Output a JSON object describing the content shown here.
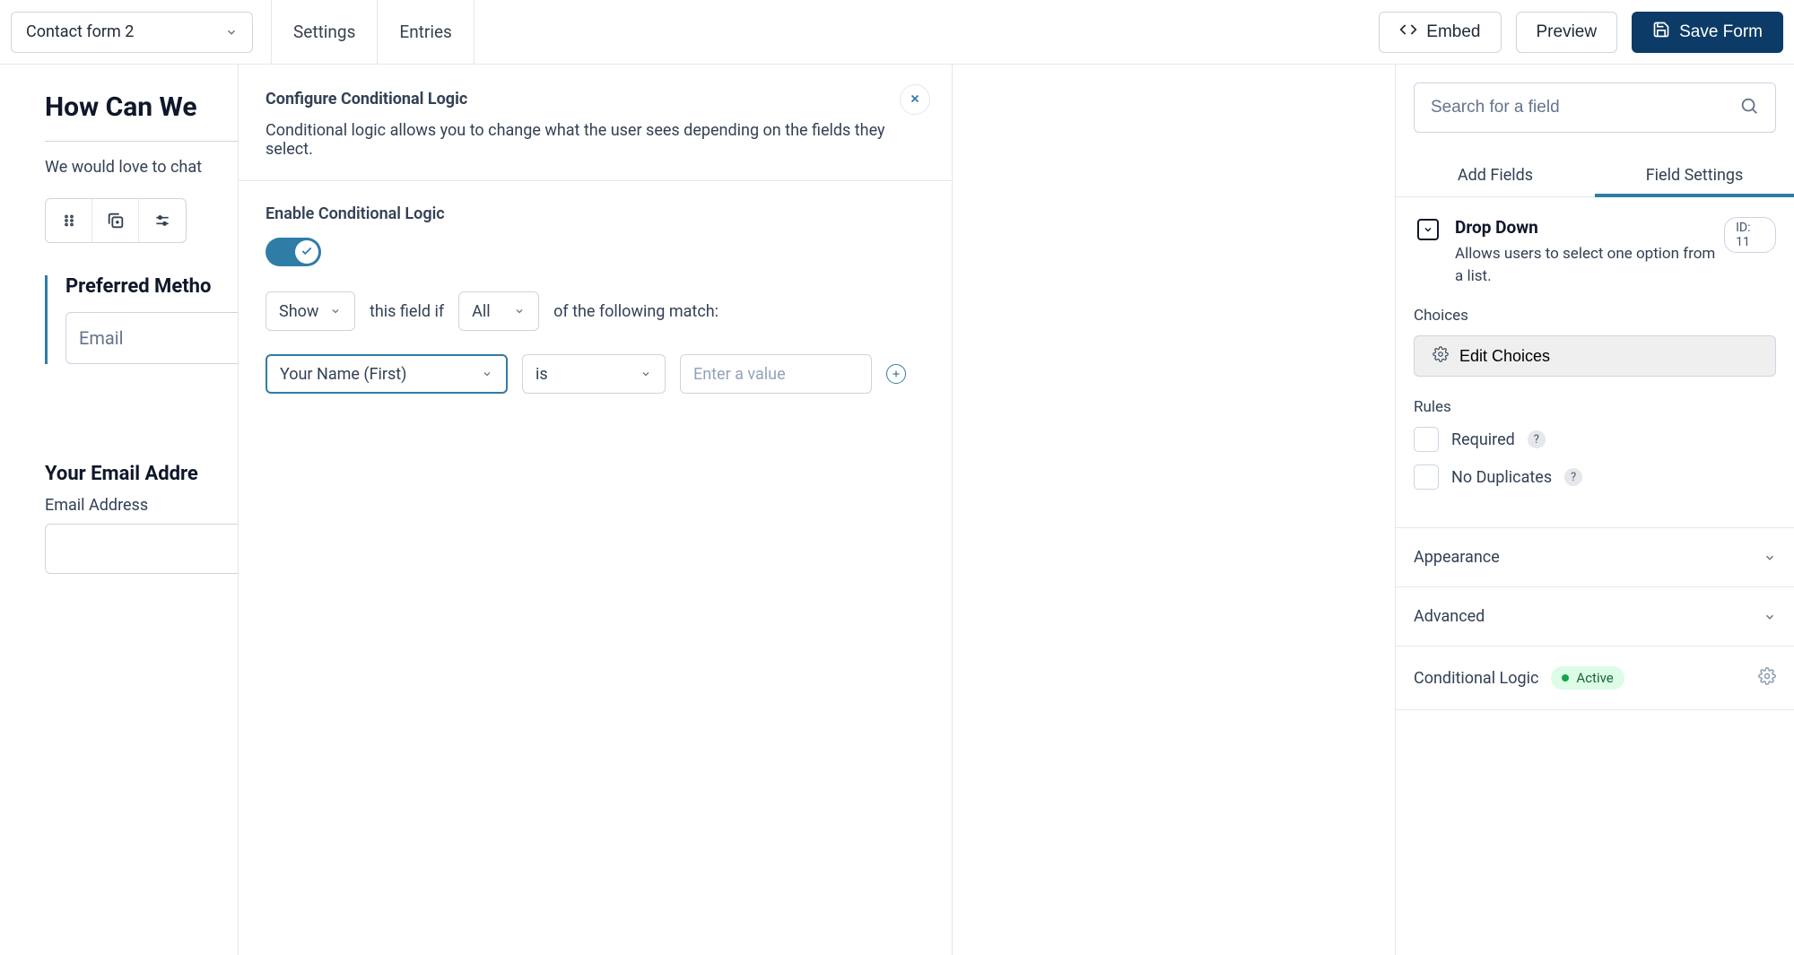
{
  "topbar": {
    "form_name": "Contact form 2",
    "nav": {
      "settings": "Settings",
      "entries": "Entries"
    },
    "embed": "Embed",
    "preview": "Preview",
    "save": "Save Form"
  },
  "canvas": {
    "heading_truncated": "How Can We",
    "description_truncated": "We would love to chat",
    "selected_field_label_truncated": "Preferred Metho",
    "selected_field_value": "Email",
    "email_block": {
      "heading": "Your Email Addre",
      "sublabel": "Email Address"
    }
  },
  "cond_panel": {
    "title": "Configure Conditional Logic",
    "description": "Conditional logic allows you to change what the user sees depending on the fields they select.",
    "enable_label": "Enable Conditional Logic",
    "toggle_on": true,
    "rule_sentence": {
      "action_select": "Show",
      "mid_text_1": "this field if",
      "match_select": "All",
      "mid_text_2": "of the following match:"
    },
    "rule": {
      "field": "Your Name (First)",
      "operator": "is",
      "value_placeholder": "Enter a value"
    }
  },
  "sidebar": {
    "search_placeholder": "Search for a field",
    "tabs": {
      "add": "Add Fields",
      "settings": "Field Settings"
    },
    "field": {
      "type": "Drop Down",
      "id_badge": "ID: 11",
      "description": "Allows users to select one option from a list."
    },
    "choices": {
      "label": "Choices",
      "edit_button": "Edit Choices"
    },
    "rules": {
      "label": "Rules",
      "required": "Required",
      "no_duplicates": "No Duplicates"
    },
    "accordion": {
      "appearance": "Appearance",
      "advanced": "Advanced",
      "conditional_logic": "Conditional Logic",
      "active_badge": "Active"
    }
  }
}
